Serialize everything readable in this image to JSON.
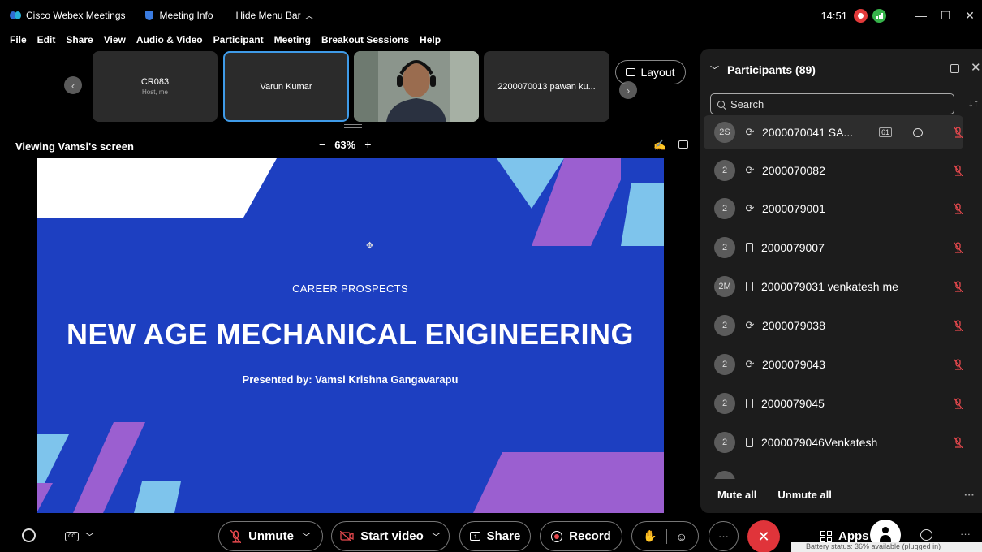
{
  "titlebar": {
    "app_name": "Cisco Webex Meetings",
    "meeting_info": "Meeting Info",
    "hide_menu": "Hide Menu Bar",
    "clock": "14:51"
  },
  "menu": [
    "File",
    "Edit",
    "Share",
    "View",
    "Audio & Video",
    "Participant",
    "Meeting",
    "Breakout Sessions",
    "Help"
  ],
  "strip": {
    "tiles": [
      {
        "name": "CR083",
        "sub": "Host, me"
      },
      {
        "name": "Varun Kumar",
        "sub": ""
      },
      {
        "name": "",
        "sub": ""
      },
      {
        "name": "2200070013 pawan ku...",
        "sub": ""
      }
    ],
    "layout_label": "Layout"
  },
  "viewbar": {
    "label": "Viewing Vamsi's screen",
    "zoom_minus": "−",
    "zoom": "63%",
    "zoom_plus": "+"
  },
  "slide": {
    "subtitle": "CAREER PROSPECTS",
    "title": "NEW AGE MECHANICAL ENGINEERING",
    "presenter": "Presented by: Vamsi Krishna Gangavarapu",
    "colors": {
      "background": "#1d3fc1",
      "purple": "#9b5fd0",
      "light_blue": "#7ec4ec",
      "white": "#ffffff"
    }
  },
  "panel": {
    "title": "Participants (89)",
    "search_placeholder": "Search",
    "participants": [
      {
        "initials": "2S",
        "device": "headset",
        "name": "2000070041 SA..."
      },
      {
        "initials": "2",
        "device": "headset",
        "name": "2000070082"
      },
      {
        "initials": "2",
        "device": "headset",
        "name": "2000079001"
      },
      {
        "initials": "2",
        "device": "phone",
        "name": "2000079007"
      },
      {
        "initials": "2M",
        "device": "phone",
        "name": "2000079031 venkatesh me"
      },
      {
        "initials": "2",
        "device": "headset",
        "name": "2000079038"
      },
      {
        "initials": "2",
        "device": "headset",
        "name": "2000079043"
      },
      {
        "initials": "2",
        "device": "phone",
        "name": "2000079045"
      },
      {
        "initials": "2",
        "device": "phone",
        "name": "2000079046Venkatesh"
      }
    ],
    "mute_all": "Mute all",
    "unmute_all": "Unmute all"
  },
  "bottombar": {
    "unmute": "Unmute",
    "start_video": "Start video",
    "share": "Share",
    "record": "Record",
    "apps": "Apps",
    "tooltip": "Battery status: 36% available (plugged in)"
  },
  "colors": {
    "accent": "#3f9be8",
    "end_red": "#e0343a",
    "mute_red": "#e5484d"
  }
}
